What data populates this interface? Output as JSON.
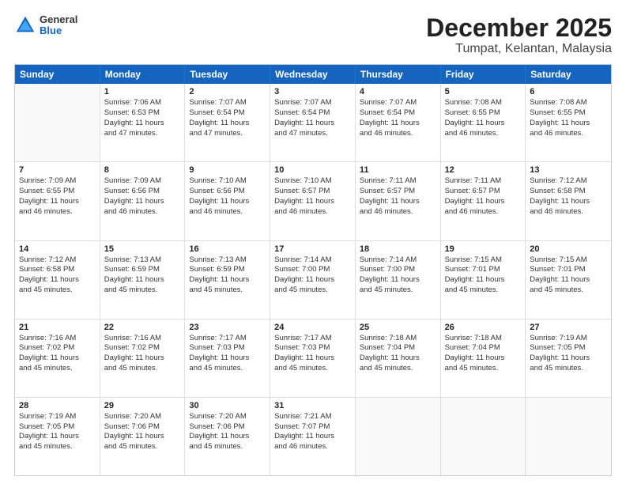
{
  "logo": {
    "general": "General",
    "blue": "Blue"
  },
  "title": "December 2025",
  "subtitle": "Tumpat, Kelantan, Malaysia",
  "days": [
    "Sunday",
    "Monday",
    "Tuesday",
    "Wednesday",
    "Thursday",
    "Friday",
    "Saturday"
  ],
  "weeks": [
    [
      {
        "day": "",
        "lines": []
      },
      {
        "day": "1",
        "lines": [
          "Sunrise: 7:06 AM",
          "Sunset: 6:53 PM",
          "Daylight: 11 hours",
          "and 47 minutes."
        ]
      },
      {
        "day": "2",
        "lines": [
          "Sunrise: 7:07 AM",
          "Sunset: 6:54 PM",
          "Daylight: 11 hours",
          "and 47 minutes."
        ]
      },
      {
        "day": "3",
        "lines": [
          "Sunrise: 7:07 AM",
          "Sunset: 6:54 PM",
          "Daylight: 11 hours",
          "and 47 minutes."
        ]
      },
      {
        "day": "4",
        "lines": [
          "Sunrise: 7:07 AM",
          "Sunset: 6:54 PM",
          "Daylight: 11 hours",
          "and 46 minutes."
        ]
      },
      {
        "day": "5",
        "lines": [
          "Sunrise: 7:08 AM",
          "Sunset: 6:55 PM",
          "Daylight: 11 hours",
          "and 46 minutes."
        ]
      },
      {
        "day": "6",
        "lines": [
          "Sunrise: 7:08 AM",
          "Sunset: 6:55 PM",
          "Daylight: 11 hours",
          "and 46 minutes."
        ]
      }
    ],
    [
      {
        "day": "7",
        "lines": [
          "Sunrise: 7:09 AM",
          "Sunset: 6:55 PM",
          "Daylight: 11 hours",
          "and 46 minutes."
        ]
      },
      {
        "day": "8",
        "lines": [
          "Sunrise: 7:09 AM",
          "Sunset: 6:56 PM",
          "Daylight: 11 hours",
          "and 46 minutes."
        ]
      },
      {
        "day": "9",
        "lines": [
          "Sunrise: 7:10 AM",
          "Sunset: 6:56 PM",
          "Daylight: 11 hours",
          "and 46 minutes."
        ]
      },
      {
        "day": "10",
        "lines": [
          "Sunrise: 7:10 AM",
          "Sunset: 6:57 PM",
          "Daylight: 11 hours",
          "and 46 minutes."
        ]
      },
      {
        "day": "11",
        "lines": [
          "Sunrise: 7:11 AM",
          "Sunset: 6:57 PM",
          "Daylight: 11 hours",
          "and 46 minutes."
        ]
      },
      {
        "day": "12",
        "lines": [
          "Sunrise: 7:11 AM",
          "Sunset: 6:57 PM",
          "Daylight: 11 hours",
          "and 46 minutes."
        ]
      },
      {
        "day": "13",
        "lines": [
          "Sunrise: 7:12 AM",
          "Sunset: 6:58 PM",
          "Daylight: 11 hours",
          "and 46 minutes."
        ]
      }
    ],
    [
      {
        "day": "14",
        "lines": [
          "Sunrise: 7:12 AM",
          "Sunset: 6:58 PM",
          "Daylight: 11 hours",
          "and 45 minutes."
        ]
      },
      {
        "day": "15",
        "lines": [
          "Sunrise: 7:13 AM",
          "Sunset: 6:59 PM",
          "Daylight: 11 hours",
          "and 45 minutes."
        ]
      },
      {
        "day": "16",
        "lines": [
          "Sunrise: 7:13 AM",
          "Sunset: 6:59 PM",
          "Daylight: 11 hours",
          "and 45 minutes."
        ]
      },
      {
        "day": "17",
        "lines": [
          "Sunrise: 7:14 AM",
          "Sunset: 7:00 PM",
          "Daylight: 11 hours",
          "and 45 minutes."
        ]
      },
      {
        "day": "18",
        "lines": [
          "Sunrise: 7:14 AM",
          "Sunset: 7:00 PM",
          "Daylight: 11 hours",
          "and 45 minutes."
        ]
      },
      {
        "day": "19",
        "lines": [
          "Sunrise: 7:15 AM",
          "Sunset: 7:01 PM",
          "Daylight: 11 hours",
          "and 45 minutes."
        ]
      },
      {
        "day": "20",
        "lines": [
          "Sunrise: 7:15 AM",
          "Sunset: 7:01 PM",
          "Daylight: 11 hours",
          "and 45 minutes."
        ]
      }
    ],
    [
      {
        "day": "21",
        "lines": [
          "Sunrise: 7:16 AM",
          "Sunset: 7:02 PM",
          "Daylight: 11 hours",
          "and 45 minutes."
        ]
      },
      {
        "day": "22",
        "lines": [
          "Sunrise: 7:16 AM",
          "Sunset: 7:02 PM",
          "Daylight: 11 hours",
          "and 45 minutes."
        ]
      },
      {
        "day": "23",
        "lines": [
          "Sunrise: 7:17 AM",
          "Sunset: 7:03 PM",
          "Daylight: 11 hours",
          "and 45 minutes."
        ]
      },
      {
        "day": "24",
        "lines": [
          "Sunrise: 7:17 AM",
          "Sunset: 7:03 PM",
          "Daylight: 11 hours",
          "and 45 minutes."
        ]
      },
      {
        "day": "25",
        "lines": [
          "Sunrise: 7:18 AM",
          "Sunset: 7:04 PM",
          "Daylight: 11 hours",
          "and 45 minutes."
        ]
      },
      {
        "day": "26",
        "lines": [
          "Sunrise: 7:18 AM",
          "Sunset: 7:04 PM",
          "Daylight: 11 hours",
          "and 45 minutes."
        ]
      },
      {
        "day": "27",
        "lines": [
          "Sunrise: 7:19 AM",
          "Sunset: 7:05 PM",
          "Daylight: 11 hours",
          "and 45 minutes."
        ]
      }
    ],
    [
      {
        "day": "28",
        "lines": [
          "Sunrise: 7:19 AM",
          "Sunset: 7:05 PM",
          "Daylight: 11 hours",
          "and 45 minutes."
        ]
      },
      {
        "day": "29",
        "lines": [
          "Sunrise: 7:20 AM",
          "Sunset: 7:06 PM",
          "Daylight: 11 hours",
          "and 45 minutes."
        ]
      },
      {
        "day": "30",
        "lines": [
          "Sunrise: 7:20 AM",
          "Sunset: 7:06 PM",
          "Daylight: 11 hours",
          "and 45 minutes."
        ]
      },
      {
        "day": "31",
        "lines": [
          "Sunrise: 7:21 AM",
          "Sunset: 7:07 PM",
          "Daylight: 11 hours",
          "and 46 minutes."
        ]
      },
      {
        "day": "",
        "lines": []
      },
      {
        "day": "",
        "lines": []
      },
      {
        "day": "",
        "lines": []
      }
    ]
  ]
}
